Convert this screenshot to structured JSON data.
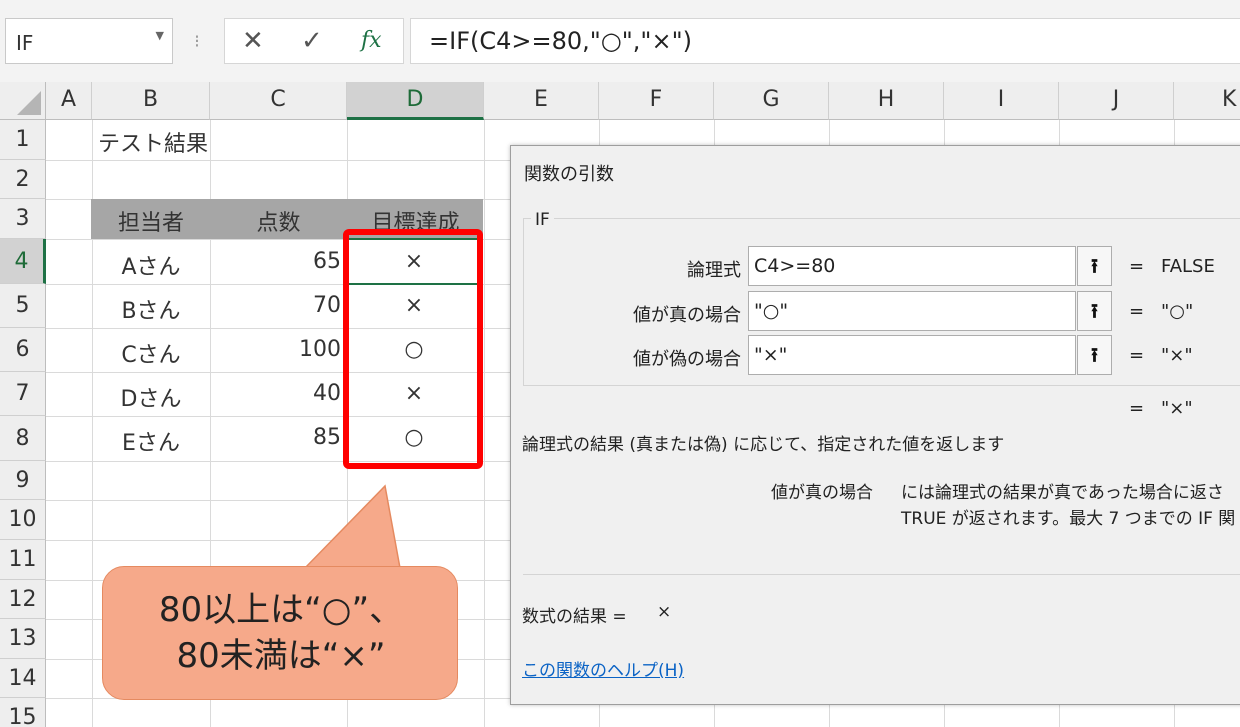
{
  "formula_bar": {
    "name_box": "IF",
    "separator": "⁝",
    "cancel": "✕",
    "enter": "✓",
    "fx": "fx",
    "formula": "=IF(C4>=80,\"○\",\"×\")"
  },
  "sheet": {
    "columns": [
      "A",
      "B",
      "C",
      "D",
      "E",
      "F",
      "G",
      "H",
      "I",
      "J",
      "K"
    ],
    "rows": [
      "1",
      "2",
      "3",
      "4",
      "5",
      "6",
      "7",
      "8",
      "9",
      "10",
      "11",
      "12",
      "13",
      "14",
      "15"
    ],
    "title": "テスト結果",
    "headers": {
      "person": "担当者",
      "score": "点数",
      "goal": "目標達成"
    },
    "data": [
      {
        "person": "Aさん",
        "score": "65",
        "goal": "×"
      },
      {
        "person": "Bさん",
        "score": "70",
        "goal": "×"
      },
      {
        "person": "Cさん",
        "score": "100",
        "goal": "○"
      },
      {
        "person": "Dさん",
        "score": "40",
        "goal": "×"
      },
      {
        "person": "Eさん",
        "score": "85",
        "goal": "○"
      }
    ],
    "header_fill_color": "#a6a6a6",
    "highlight_color": "#ff0000",
    "selection_color": "#1e7145"
  },
  "callout": {
    "line1": "80以上は“○”、",
    "line2": "80未満は“×”",
    "color": "#f6a98a"
  },
  "dialog": {
    "title": "関数の引数",
    "group": "IF",
    "args": [
      {
        "label": "論理式",
        "value": "C4>=80",
        "button": "⭱",
        "eq": "=",
        "result": "FALSE"
      },
      {
        "label": "値が真の場合",
        "value": "\"○\"",
        "button": "⭱",
        "eq": "=",
        "result": "\"○\""
      },
      {
        "label": "値が偽の場合",
        "value": "\"×\"",
        "button": "⭱",
        "eq": "=",
        "result": "\"×\""
      }
    ],
    "overall_eq": "=",
    "overall_result": "\"×\"",
    "description": "論理式の結果 (真または偽) に応じて、指定された値を返します",
    "arg_help_label": "値が真の場合",
    "arg_help_line1": "には論理式の結果が真であった場合に返さ",
    "arg_help_line2": "TRUE が返されます。最大 7 つまでの IF 関",
    "formula_result_label": "数式の結果 =",
    "formula_result_value": "×",
    "help_link": "この関数のヘルプ(H)"
  }
}
